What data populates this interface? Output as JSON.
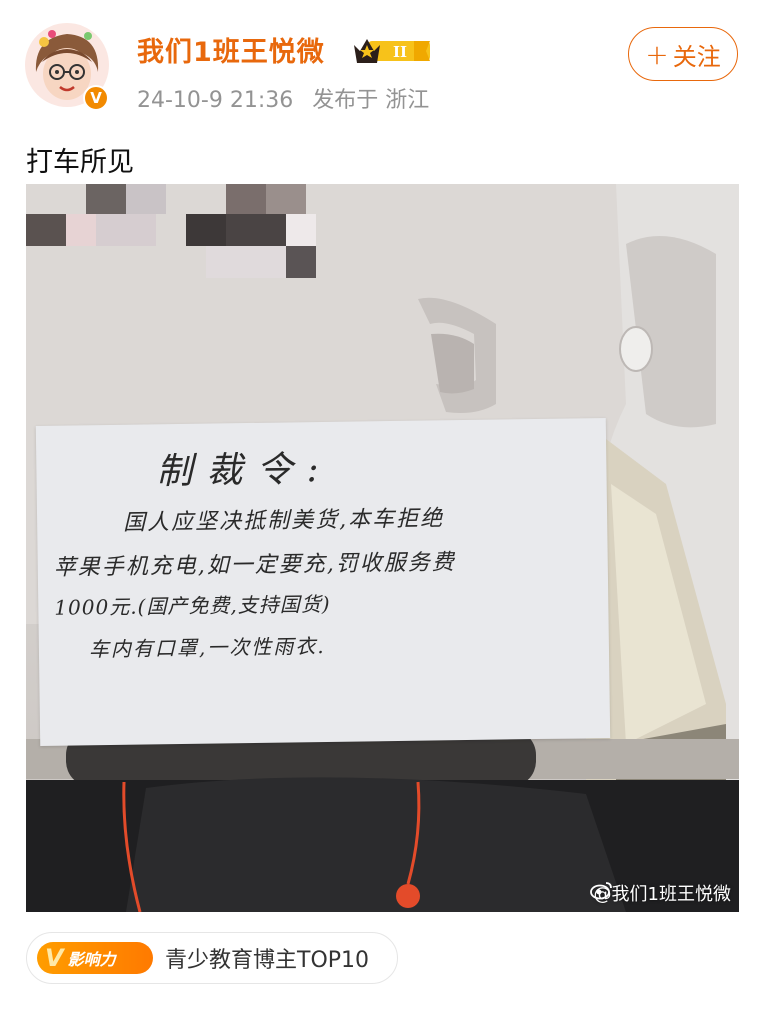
{
  "user": {
    "name": "我们1班王悦微",
    "verified_mark": "V",
    "level_badge": "II"
  },
  "post_meta": {
    "date": "24-10-9 21:36",
    "location": "发布于 浙江"
  },
  "actions": {
    "follow_plus": "+",
    "follow_label": "关注"
  },
  "post": {
    "text": "打车所见"
  },
  "photo": {
    "note_title": "制裁令:",
    "note_lines": [
      "国人应坚决抵制美货,本车拒绝",
      "苹果手机充电,如一定要充,罚收服务费",
      "1000元.(国产免费,支持国货)",
      "车内有口罩,一次性雨衣."
    ],
    "watermark": "@我们1班王悦微"
  },
  "influence_badge": {
    "icon_letter": "V",
    "icon_label": "影响力",
    "text": "青少教育博主TOP10"
  },
  "colors": {
    "accent": "#e8680c",
    "meta_gray": "#939393",
    "badge_orange": "#ff8a00"
  }
}
